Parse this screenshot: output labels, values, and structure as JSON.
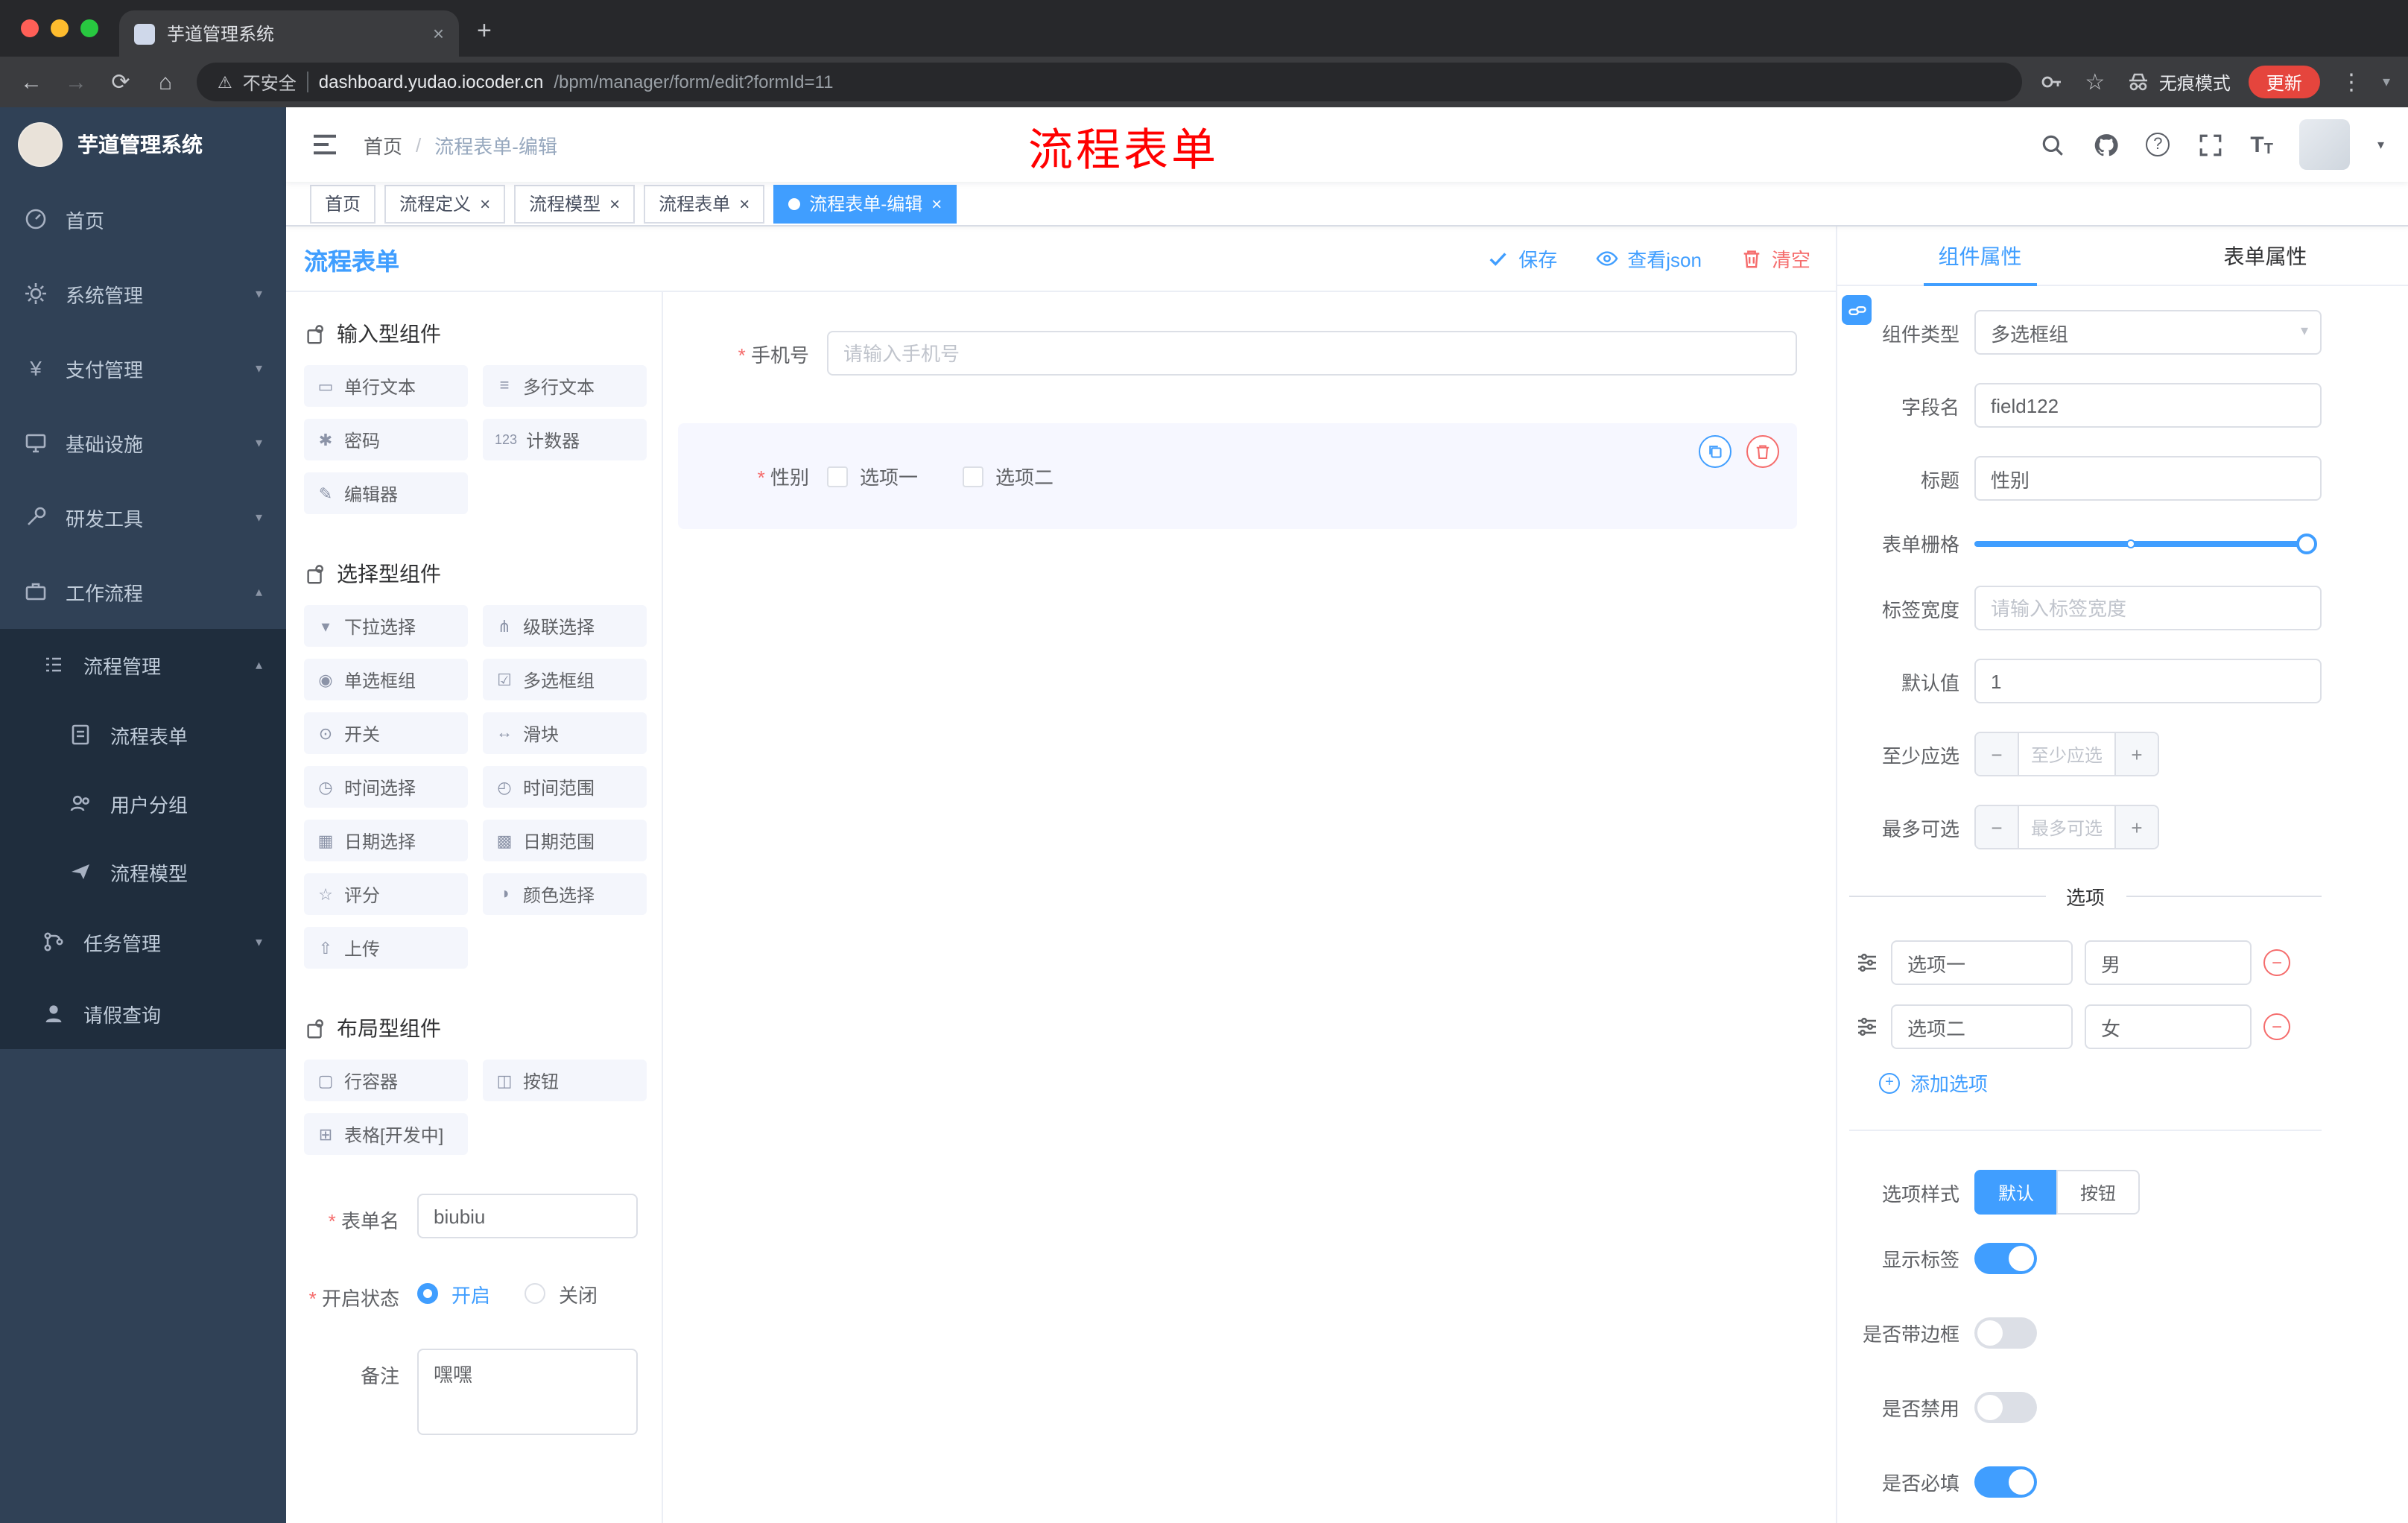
{
  "icons": {
    "close": "×",
    "plus": "+",
    "back": "←",
    "forward": "→",
    "reload": "⟳",
    "home": "⌂",
    "warning": "⚠",
    "star": "☆",
    "more": "⋮",
    "caret_down": "▾",
    "caret_up": "▴",
    "minus": "−",
    "slash": "/",
    "question": "?",
    "yen": "¥",
    "text_big": "T",
    "text_small": "T"
  },
  "colors": {
    "primary": "#409eff",
    "danger": "#f56c6c",
    "annotation": "#ff0000"
  },
  "browser": {
    "tab_title": "芋道管理系统",
    "security_label": "不安全",
    "url_domain": "dashboard.yudao.iocoder.cn",
    "url_path": "/bpm/manager/form/edit?formId=11",
    "incognito_label": "无痕模式",
    "update_label": "更新"
  },
  "sidebar": {
    "logo_title": "芋道管理系统",
    "items": [
      {
        "label": "首页"
      },
      {
        "label": "系统管理"
      },
      {
        "label": "支付管理"
      },
      {
        "label": "基础设施"
      },
      {
        "label": "研发工具"
      },
      {
        "label": "工作流程"
      },
      {
        "label": "流程管理"
      },
      {
        "label": "流程表单"
      },
      {
        "label": "用户分组"
      },
      {
        "label": "流程模型"
      },
      {
        "label": "任务管理"
      },
      {
        "label": "请假查询"
      }
    ]
  },
  "header": {
    "breadcrumb_home": "首页",
    "breadcrumb_current": "流程表单-编辑",
    "annotation": "流程表单"
  },
  "tags": [
    {
      "label": "首页"
    },
    {
      "label": "流程定义"
    },
    {
      "label": "流程模型"
    },
    {
      "label": "流程表单"
    },
    {
      "label": "流程表单-编辑",
      "active": true
    }
  ],
  "designer": {
    "title": "流程表单",
    "save_label": "保存",
    "view_json_label": "查看json",
    "clear_label": "清空",
    "groups": [
      {
        "title": "输入型组件"
      },
      {
        "title": "选择型组件"
      },
      {
        "title": "布局型组件"
      }
    ],
    "chips": {
      "input": [
        {
          "icon": "▭",
          "label": "单行文本"
        },
        {
          "icon": "≡",
          "label": "多行文本"
        },
        {
          "icon": "✱",
          "label": "密码"
        },
        {
          "icon": "123",
          "label": "计数器"
        },
        {
          "icon": "✎",
          "label": "编辑器"
        }
      ],
      "select": [
        {
          "icon": "▾",
          "label": "下拉选择"
        },
        {
          "icon": "⋔",
          "label": "级联选择"
        },
        {
          "icon": "◉",
          "label": "单选框组"
        },
        {
          "icon": "☑",
          "label": "多选框组"
        },
        {
          "icon": "⊙",
          "label": "开关"
        },
        {
          "icon": "↔",
          "label": "滑块"
        },
        {
          "icon": "◷",
          "label": "时间选择"
        },
        {
          "icon": "◴",
          "label": "时间范围"
        },
        {
          "icon": "▦",
          "label": "日期选择"
        },
        {
          "icon": "▩",
          "label": "日期范围"
        },
        {
          "icon": "☆",
          "label": "评分"
        },
        {
          "icon": "◑",
          "label": "颜色选择"
        },
        {
          "icon": "⇧",
          "label": "上传"
        }
      ],
      "layout": [
        {
          "icon": "▢",
          "label": "行容器"
        },
        {
          "icon": "◫",
          "label": "按钮"
        },
        {
          "icon": "⊞",
          "label": "表格[开发中]"
        }
      ]
    },
    "meta": {
      "name_label": "表单名",
      "name_value": "biubiu",
      "status_label": "开启状态",
      "status_on": "开启",
      "status_off": "关闭",
      "remark_label": "备注",
      "remark_value": "嘿嘿"
    },
    "canvas": {
      "phone_label": "手机号",
      "phone_placeholder": "请输入手机号",
      "gender_label": "性别",
      "gender_option1": "选项一",
      "gender_option2": "选项二"
    }
  },
  "props": {
    "tab_component": "组件属性",
    "tab_form": "表单属性",
    "type_label": "组件类型",
    "type_value": "多选框组",
    "field_label": "字段名",
    "field_value": "field122",
    "title_label": "标题",
    "title_value": "性别",
    "grid_label": "表单栅格",
    "width_label": "标签宽度",
    "width_placeholder": "请输入标签宽度",
    "default_label": "默认值",
    "default_value": "1",
    "min_label": "至少应选",
    "min_placeholder": "至少应选",
    "max_label": "最多可选",
    "max_placeholder": "最多可选",
    "options_title": "选项",
    "options": [
      {
        "label": "选项一",
        "value": "男"
      },
      {
        "label": "选项二",
        "value": "女"
      }
    ],
    "add_option_label": "添加选项",
    "style_label": "选项样式",
    "style_default": "默认",
    "style_button": "按钮",
    "toggles": [
      {
        "label": "显示标签",
        "on": true
      },
      {
        "label": "是否带边框",
        "on": false
      },
      {
        "label": "是否禁用",
        "on": false
      },
      {
        "label": "是否必填",
        "on": true
      }
    ]
  }
}
